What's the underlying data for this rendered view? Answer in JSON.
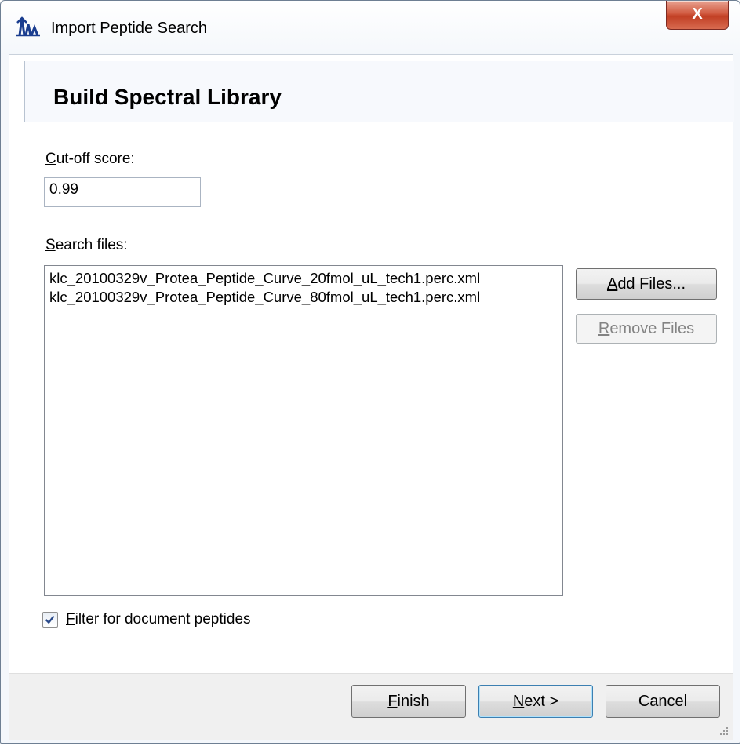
{
  "window": {
    "title": "Import Peptide Search",
    "close_symbol": "X"
  },
  "header": {
    "title": "Build Spectral Library"
  },
  "cutoff": {
    "label_first": "C",
    "label_rest": "ut-off score:",
    "value": "0.99"
  },
  "search_files": {
    "label_first": "S",
    "label_rest": "earch files:",
    "items": [
      "klc_20100329v_Protea_Peptide_Curve_20fmol_uL_tech1.perc.xml",
      "klc_20100329v_Protea_Peptide_Curve_80fmol_uL_tech1.perc.xml"
    ]
  },
  "buttons": {
    "add_first": "A",
    "add_rest": "dd Files...",
    "remove_first": "R",
    "remove_rest": "emove Files",
    "finish_first": "F",
    "finish_rest": "inish",
    "next_first": "N",
    "next_rest": "ext >",
    "cancel": "Cancel"
  },
  "filter": {
    "label_first": "F",
    "label_rest": "ilter for document peptides",
    "checked": true
  },
  "icons": {
    "app": "chromatogram-peaks-icon",
    "check": "checkmark-icon",
    "close": "close-icon",
    "grip": "resize-grip-icon"
  }
}
